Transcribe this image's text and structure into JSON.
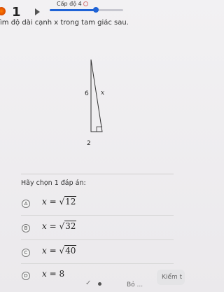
{
  "header": {
    "question_number": "1",
    "level_label": "Cấp độ 4",
    "progress_fraction": 0.62
  },
  "prompt": "ìm độ dài cạnh x trong tam giác sau.",
  "figure": {
    "left_side": "6",
    "hypotenuse": "x",
    "base": "2"
  },
  "choose_label": "Hãy chọn 1 đáp án:",
  "options": [
    {
      "letter": "A",
      "lhs": "x",
      "eq": " = ",
      "sqrt": "12",
      "value": ""
    },
    {
      "letter": "B",
      "lhs": "x",
      "eq": " = ",
      "sqrt": "32",
      "value": ""
    },
    {
      "letter": "C",
      "lhs": "x",
      "eq": " = ",
      "sqrt": "40",
      "value": ""
    },
    {
      "letter": "D",
      "lhs": "x",
      "eq": " = ",
      "sqrt": "",
      "value": "8"
    }
  ],
  "footer": {
    "skip_label": "Bỏ ...",
    "check_label": "Kiểm t"
  }
}
